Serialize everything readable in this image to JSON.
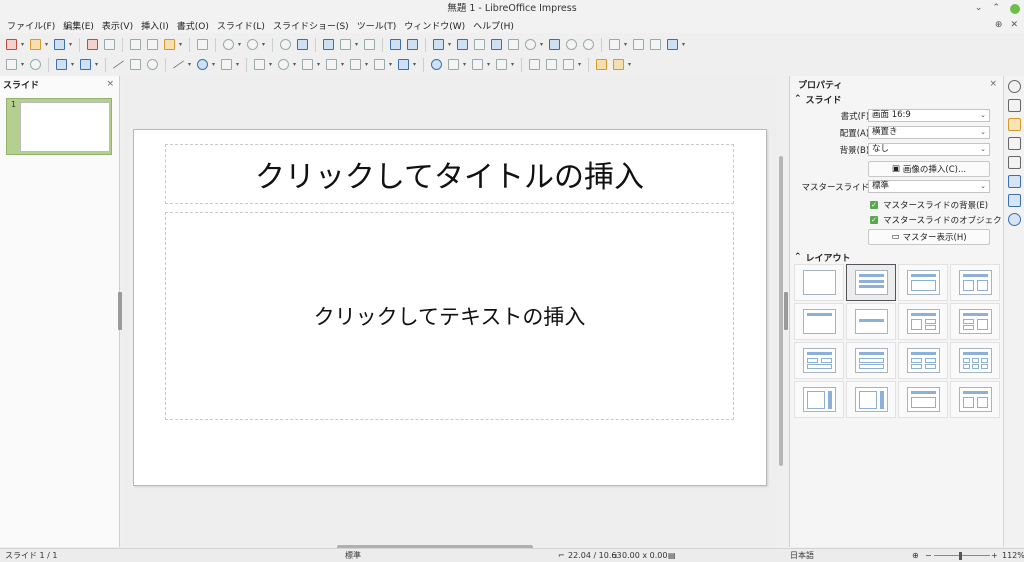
{
  "window": {
    "title": "無題 1 - LibreOffice Impress"
  },
  "menu": [
    "ファイル(F)",
    "編集(E)",
    "表示(V)",
    "挿入(I)",
    "書式(O)",
    "スライド(L)",
    "スライドショー(S)",
    "ツール(T)",
    "ウィンドウ(W)",
    "ヘルプ(H)"
  ],
  "slide_pane": {
    "title": "スライド",
    "close": "×",
    "thumbnail_number": "1"
  },
  "slide": {
    "title_placeholder": "クリックしてタイトルの挿入",
    "body_placeholder": "クリックしてテキストの挿入"
  },
  "properties": {
    "title": "プロパティ",
    "close": "×",
    "slide_section": "スライド",
    "format_label": "書式(F):",
    "format_value": "画面 16:9",
    "orientation_label": "配置(A):",
    "orientation_value": "横置き",
    "background_label": "背景(B):",
    "background_value": "なし",
    "insert_image_button": "画像の挿入(C)...",
    "master_slide_label": "マスタースライド:",
    "master_slide_value": "標準",
    "master_bg_check": "マスタースライドの背景(E)",
    "master_objects_check": "マスタースライドのオブジェク",
    "master_view_button": "マスター表示(H)",
    "layout_section": "レイアウト"
  },
  "statusbar": {
    "slide_count": "スライド 1 / 1",
    "master_name": "標準",
    "position": "22.04 / 10.63",
    "size": "0.00 x 0.00",
    "language": "日本語",
    "zoom": "112%"
  },
  "colors": {
    "accent_green": "#5aa84e",
    "thumb_selected": "#b5cf8f"
  }
}
